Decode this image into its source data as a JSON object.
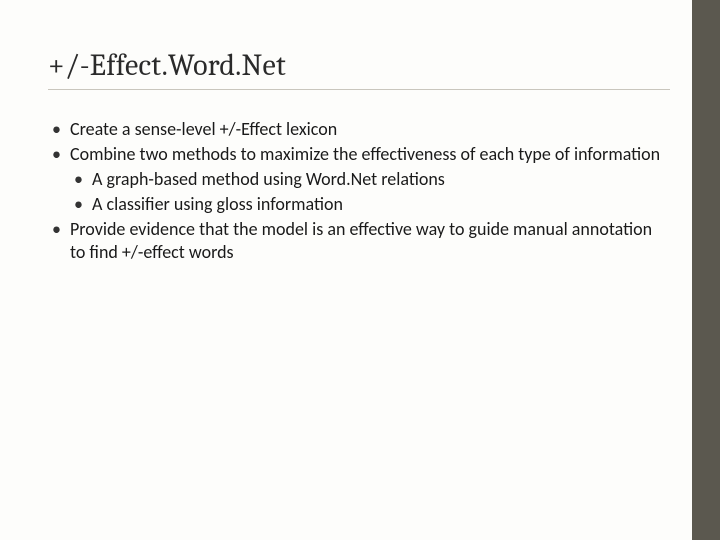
{
  "slide": {
    "title": "+/-Effect.Word.Net",
    "bullets": [
      {
        "text": "Create a sense-level +/-Effect lexicon"
      },
      {
        "text": "Combine two methods to maximize the effectiveness of each type of information",
        "children": [
          {
            "text": "A graph-based method using Word.Net relations"
          },
          {
            "text": "A classifier using gloss information"
          }
        ]
      },
      {
        "text": "Provide evidence that the model is an effective way to guide manual annotation to find +/-effect words"
      }
    ]
  }
}
